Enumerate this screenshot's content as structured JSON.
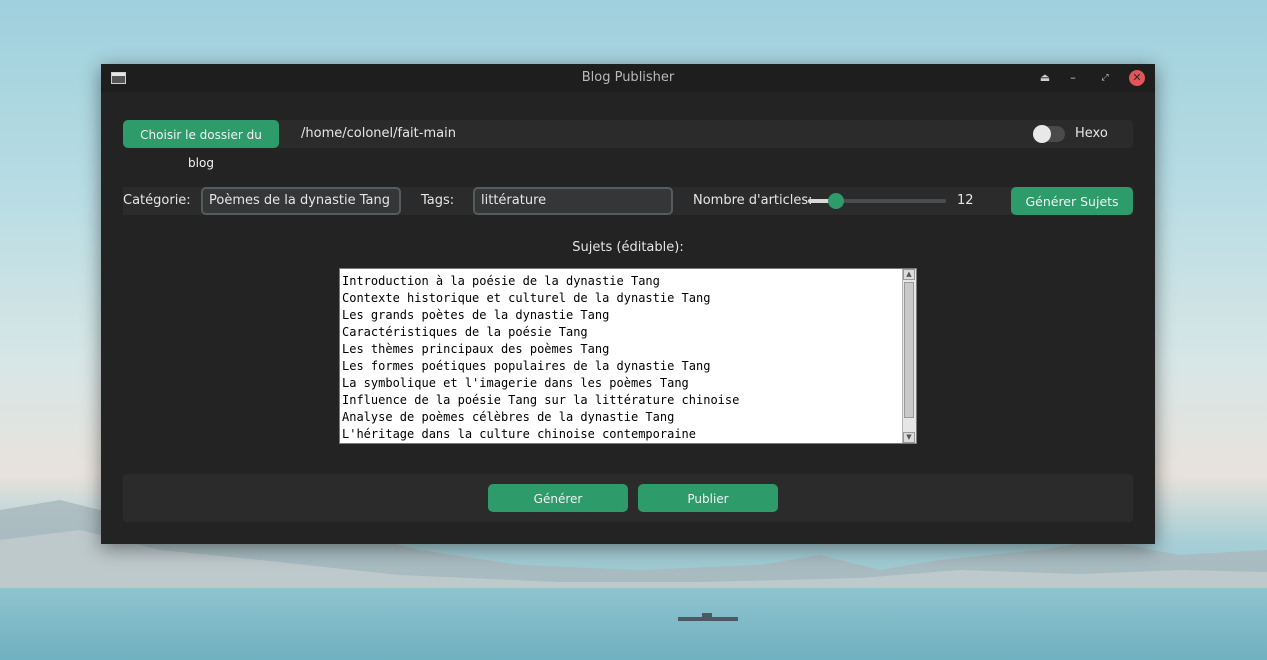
{
  "window": {
    "title": "Blog Publisher"
  },
  "top_bar": {
    "choose_folder_label": "Choisir le dossier du blog",
    "folder_path": "/home/colonel/fait-main",
    "hexo_label": "Hexo",
    "hexo_enabled": false
  },
  "settings": {
    "category_label": "Catégorie:",
    "category_value": "Poèmes de la dynastie Tang",
    "tags_label": "Tags:",
    "tags_value": "littérature",
    "count_label": "Nombre d'articles:",
    "count_value": "12",
    "count_slider_fraction": 0.2,
    "generate_subjects_label": "Générer Sujets"
  },
  "subjects": {
    "label": "Sujets (éditable):",
    "lines": [
      "Introduction à la poésie de la dynastie Tang",
      "Contexte historique et culturel de la dynastie Tang",
      "Les grands poètes de la dynastie Tang",
      "Caractéristiques de la poésie Tang",
      "Les thèmes principaux des poèmes Tang",
      "Les formes poétiques populaires de la dynastie Tang",
      "La symbolique et l'imagerie dans les poèmes Tang",
      "Influence de la poésie Tang sur la littérature chinoise",
      "Analyse de poèmes célèbres de la dynastie Tang",
      "L'héritage dans la culture chinoise contemporaine"
    ]
  },
  "actions": {
    "generate_label": "Générer",
    "publish_label": "Publier"
  },
  "colors": {
    "accent": "#2e9b6b",
    "window_bg": "#232323"
  }
}
